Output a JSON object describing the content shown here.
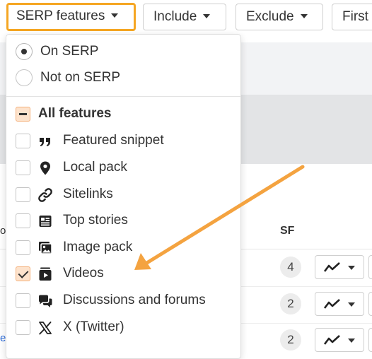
{
  "toolbar": {
    "serp_features": "SERP features",
    "include": "Include",
    "exclude": "Exclude",
    "first": "First"
  },
  "dropdown": {
    "radios": [
      {
        "label": "On SERP",
        "selected": true
      },
      {
        "label": "Not on SERP",
        "selected": false
      }
    ],
    "all_features": {
      "label": "All features",
      "state": "partial"
    },
    "features": [
      {
        "label": "Featured snippet",
        "icon": "quote-icon",
        "checked": false
      },
      {
        "label": "Local pack",
        "icon": "map-pin-icon",
        "checked": false
      },
      {
        "label": "Sitelinks",
        "icon": "link-icon",
        "checked": false
      },
      {
        "label": "Top stories",
        "icon": "newspaper-icon",
        "checked": false
      },
      {
        "label": "Image pack",
        "icon": "image-stack-icon",
        "checked": false
      },
      {
        "label": "Videos",
        "icon": "video-play-icon",
        "checked": true
      },
      {
        "label": "Discussions and forums",
        "icon": "chat-bubbles-icon",
        "checked": false
      },
      {
        "label": "X (Twitter)",
        "icon": "x-logo-icon",
        "checked": false
      }
    ]
  },
  "table": {
    "sf_header": "SF",
    "rows": [
      {
        "sf": "4"
      },
      {
        "sf": "2"
      },
      {
        "sf": "2"
      }
    ],
    "left_fragments": [
      "o",
      "e"
    ]
  },
  "colors": {
    "accent_orange": "#f5a623",
    "checkbox_fill": "#fde3cd",
    "arrow": "#f4a340"
  }
}
